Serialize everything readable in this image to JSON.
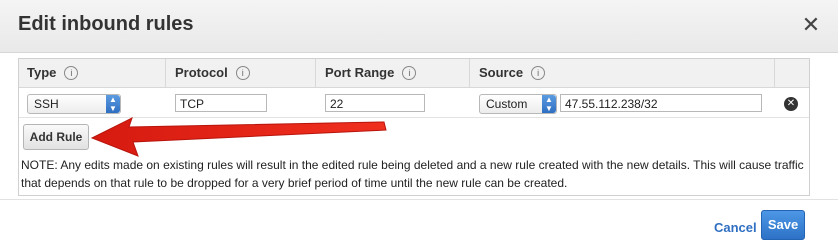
{
  "dialog": {
    "title": "Edit inbound rules",
    "close_glyph": "✕"
  },
  "table": {
    "columns": [
      {
        "label": "Type",
        "info": "i"
      },
      {
        "label": "Protocol",
        "info": "i"
      },
      {
        "label": "Port Range",
        "info": "i"
      },
      {
        "label": "Source",
        "info": "i"
      }
    ],
    "rows": [
      {
        "type": "SSH",
        "protocol": "TCP",
        "port_range": "22",
        "source_mode": "Custom",
        "source_value": "47.55.112.238/32",
        "remove_glyph": "✕"
      }
    ]
  },
  "actions": {
    "add_rule_label": "Add Rule",
    "cancel_label": "Cancel",
    "save_label": "Save"
  },
  "note_text": "NOTE: Any edits made on existing rules will result in the edited rule being deleted and a new rule created with the new details. This will cause traffic that depends on that rule to be dropped for a very brief period of time until the new rule can be created.",
  "colors": {
    "accent": "#2f6fc2",
    "annotation_arrow": "#e8261a"
  },
  "icons": {
    "close": "close-icon",
    "info": "info-icon",
    "remove_row": "remove-row-icon",
    "select_arrows": "select-arrows-icon"
  }
}
